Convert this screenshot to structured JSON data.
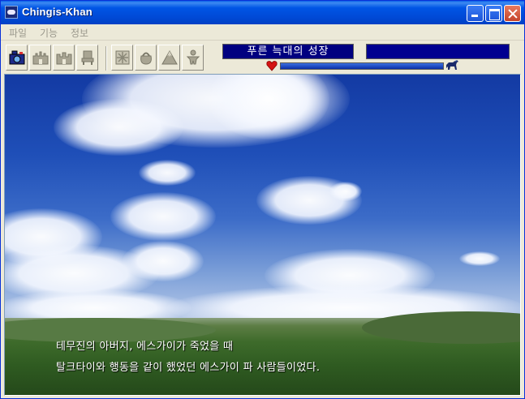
{
  "window": {
    "title": "Chingis-Khan"
  },
  "menu": {
    "items": [
      "파일",
      "기능",
      "정보"
    ]
  },
  "toolbar": {
    "tools": [
      {
        "icon": "camera-icon"
      },
      {
        "icon": "castle-icon"
      },
      {
        "icon": "castle-alt-icon"
      },
      {
        "icon": "chair-icon"
      },
      {
        "icon": "map-icon"
      },
      {
        "icon": "bag-icon"
      },
      {
        "icon": "mountain-icon"
      },
      {
        "icon": "figure-icon"
      }
    ],
    "status_text": "푸른 늑대의 성장",
    "health_icon": "heart-icon",
    "progress": 1.0,
    "end_icon": "horse-icon"
  },
  "scene": {
    "caption_line1": "테무진의 아버지, 에스가이가 죽었을 때",
    "caption_line2": "탈크타이와 행동을 같이 했었던 에스가이 파 사람들이었다."
  },
  "colors": {
    "title_bar": "#0055E5",
    "status_panel": "#000080",
    "sky": "#1f4fb8",
    "grass": "#2f5b21"
  }
}
